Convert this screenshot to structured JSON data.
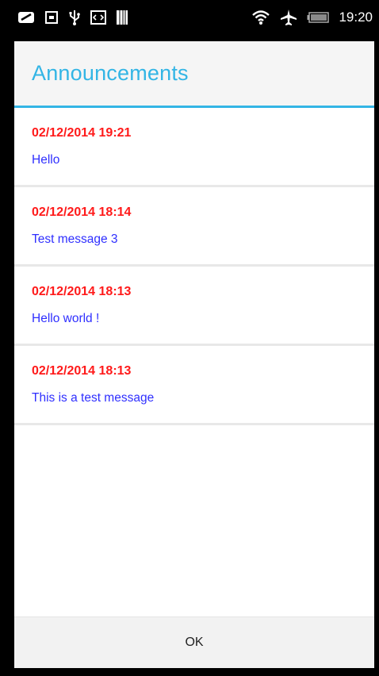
{
  "status_bar": {
    "time": "19:20",
    "left_icons": [
      "notification-icon",
      "screenshot-icon",
      "usb-icon",
      "developer-icon",
      "sim-icon"
    ],
    "right_icons": [
      "wifi-icon",
      "airplane-mode-icon",
      "battery-icon"
    ]
  },
  "dialog": {
    "title": "Announcements",
    "items": [
      {
        "date": "02/12/2014 19:21",
        "message": "Hello"
      },
      {
        "date": "02/12/2014 18:14",
        "message": "Test message 3"
      },
      {
        "date": "02/12/2014 18:13",
        "message": "Hello world !"
      },
      {
        "date": "02/12/2014 18:13",
        "message": "This is a test message"
      }
    ],
    "ok_label": "OK"
  },
  "colors": {
    "accent": "#33b5e5",
    "date": "#ff1a1a",
    "message": "#2f2fff"
  }
}
